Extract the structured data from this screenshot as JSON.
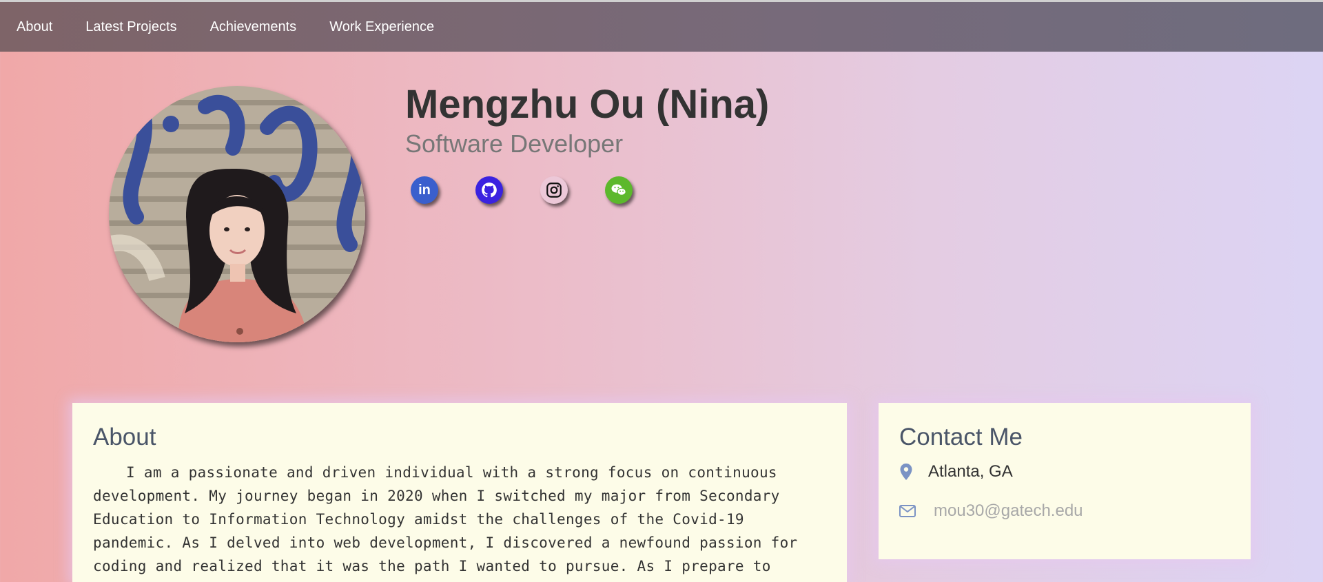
{
  "nav": {
    "items": [
      {
        "label": "About"
      },
      {
        "label": "Latest Projects"
      },
      {
        "label": "Achievements"
      },
      {
        "label": "Work Experience"
      }
    ]
  },
  "profile": {
    "name": "Mengzhu Ou (Nina)",
    "role": "Software Developer",
    "social": [
      {
        "icon": "linkedin-icon",
        "color": "#3a5fcd"
      },
      {
        "icon": "github-icon",
        "color": "#3a22e0"
      },
      {
        "icon": "instagram-icon",
        "color": "#ecc8d8"
      },
      {
        "icon": "wechat-icon",
        "color": "#5cb82c"
      }
    ],
    "linkedin_glyph": "in"
  },
  "about": {
    "title": "About",
    "text": "I am a passionate and driven individual with a strong focus on continuous development. My journey began in 2020 when I switched my major from Secondary Education to Information Technology amidst the challenges of the Covid-19 pandemic. As I delved into web development, I discovered a newfound passion for coding and realized that it was the path I wanted to pursue. As I prepare to"
  },
  "contact": {
    "title": "Contact Me",
    "location": "Atlanta, GA",
    "email": "mou30@gatech.edu"
  },
  "colors": {
    "nav_text": "#ffffff",
    "card_bg": "#fdfce8",
    "contact_icon": "#7b93c4"
  }
}
